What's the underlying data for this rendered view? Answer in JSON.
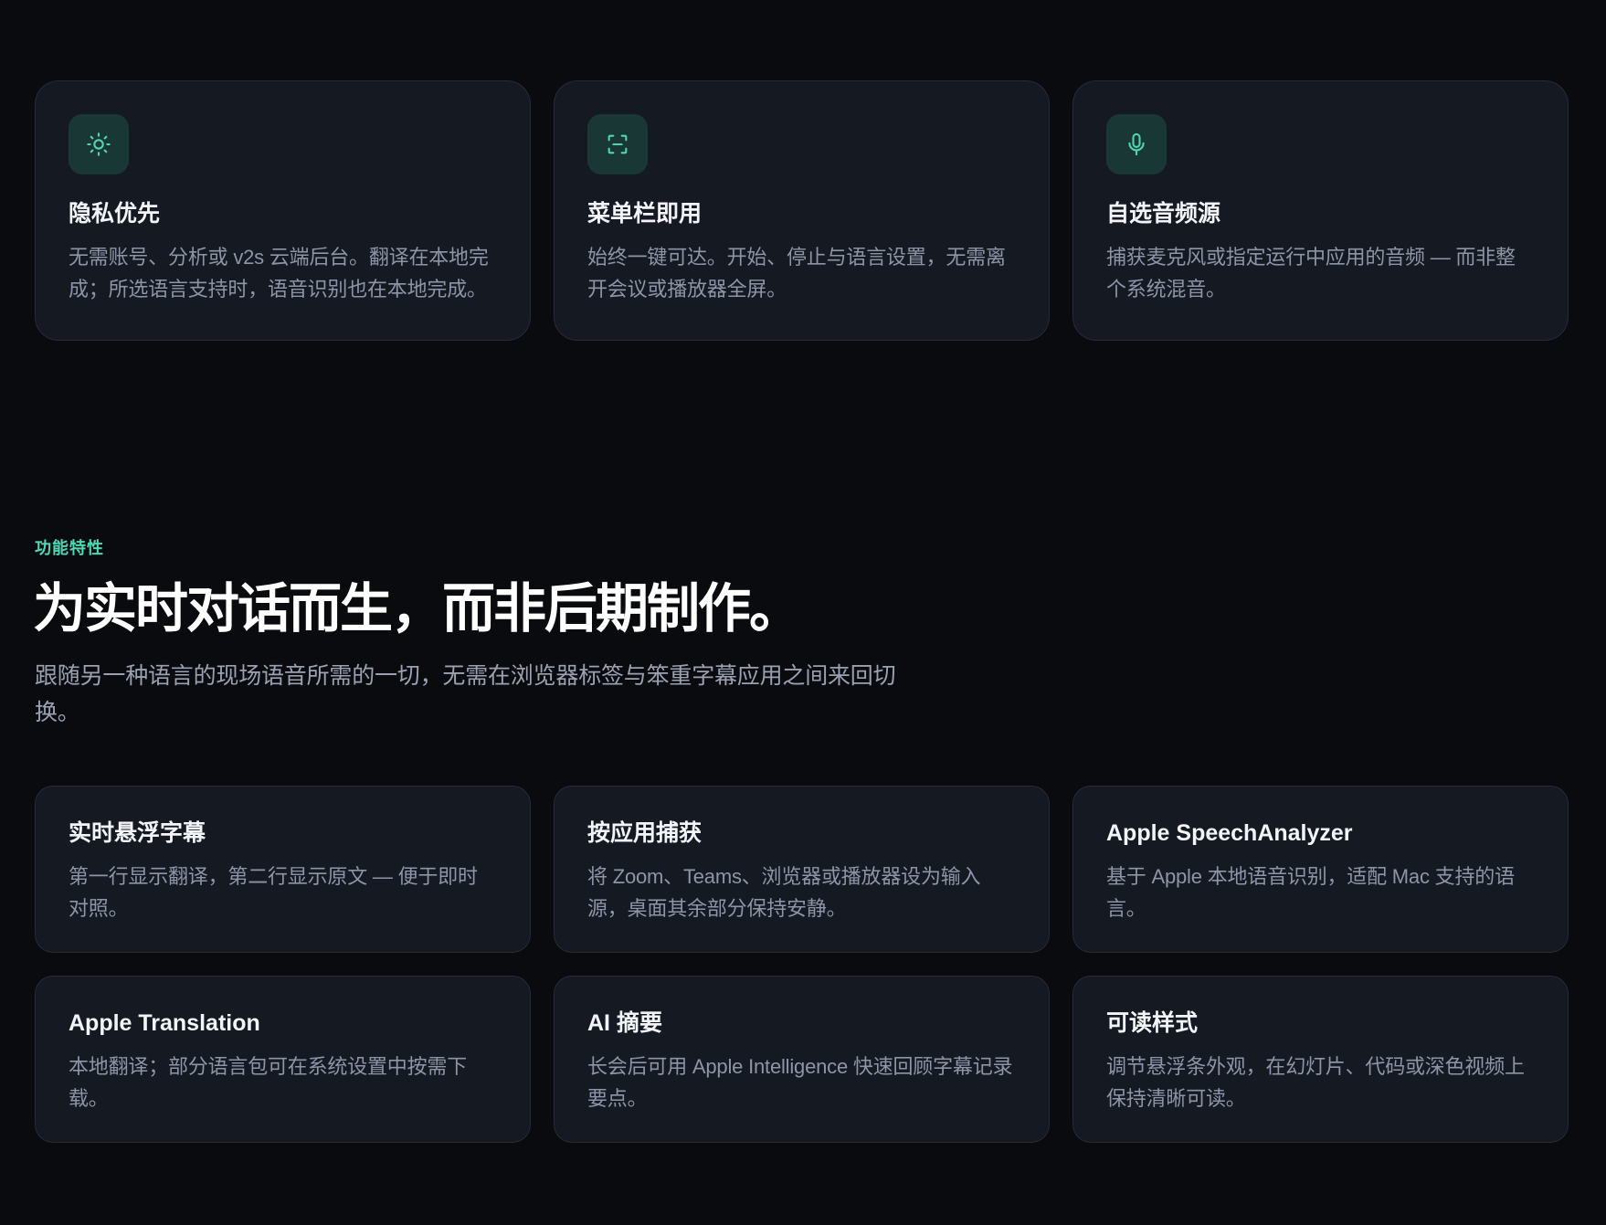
{
  "top_cards": [
    {
      "icon": "sun-icon",
      "title": "隐私优先",
      "description": "无需账号、分析或 v2s 云端后台。翻译在本地完成；所选语言支持时，语音识别也在本地完成。"
    },
    {
      "icon": "scan-icon",
      "title": "菜单栏即用",
      "description": "始终一键可达。开始、停止与语言设置，无需离开会议或播放器全屏。"
    },
    {
      "icon": "microphone-icon",
      "title": "自选音频源",
      "description": "捕获麦克风或指定运行中应用的音频 — 而非整个系统混音。"
    }
  ],
  "features_section": {
    "eyebrow": "功能特性",
    "headline": "为实时对话而生，而非后期制作。",
    "subtitle": "跟随另一种语言的现场语音所需的一切，无需在浏览器标签与笨重字幕应用之间来回切换。",
    "items": [
      {
        "title": "实时悬浮字幕",
        "description": "第一行显示翻译，第二行显示原文 — 便于即时对照。"
      },
      {
        "title": "按应用捕获",
        "description": "将 Zoom、Teams、浏览器或播放器设为输入源，桌面其余部分保持安静。"
      },
      {
        "title": "Apple SpeechAnalyzer",
        "description": "基于 Apple 本地语音识别，适配 Mac 支持的语言。"
      },
      {
        "title": "Apple Translation",
        "description": "本地翻译；部分语言包可在系统设置中按需下载。"
      },
      {
        "title": "AI 摘要",
        "description": "长会后可用 Apple Intelligence 快速回顾字幕记录要点。"
      },
      {
        "title": "可读样式",
        "description": "调节悬浮条外观，在幻灯片、代码或深色视频上保持清晰可读。"
      }
    ]
  },
  "colors": {
    "background": "#0a0b0f",
    "card_background": "#151922",
    "accent": "#50d8b5",
    "icon_background": "#193835"
  }
}
